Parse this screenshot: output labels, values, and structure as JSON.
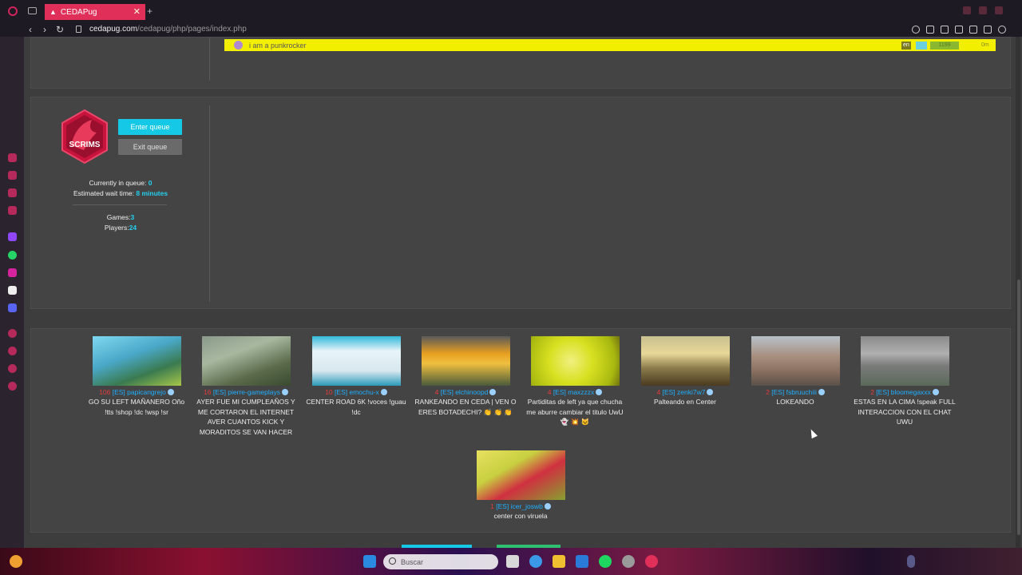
{
  "browser": {
    "tab_title": "CEDAPug",
    "new_tab": "+",
    "url_domain": "cedapug.com",
    "url_path": "/cedapug/php/pages/index.php"
  },
  "top_row": {
    "message": "i am a punkrocker",
    "lang_badge": "en",
    "rating": "1199",
    "time": "0m"
  },
  "queue": {
    "logo_text": "SCRIMS",
    "enter_label": "Enter queue",
    "exit_label": "Exit queue",
    "in_queue_label": "Currently in queue:",
    "in_queue_value": "0",
    "wait_label": "Estimated wait time:",
    "wait_value": "8 minutes",
    "games_label": "Games:",
    "games_value": "3",
    "players_label": "Players:",
    "players_value": "24"
  },
  "streams": [
    {
      "count": "106",
      "name": "[ES] papicangrejo",
      "title": "GO SU LEFT MAÑANERO Oño !tts !shop !dc !wsp !sr"
    },
    {
      "count": "16",
      "name": "[ES] pierre-gameplays",
      "title": "AYER FUE MI CUMPLEAÑOS Y ME CORTARON EL INTERNET AVER CUANTOS KICK Y MORADITOS SE VAN HACER"
    },
    {
      "count": "10",
      "name": "[ES] emochu-x",
      "title": "CENTER ROAD 6K !voces !guau !dc"
    },
    {
      "count": "4",
      "name": "[ES] elchinoopd",
      "title": "RANKEANDO EN CEDA | VEN O ERES BOTADECHI? 👏 👏 👏"
    },
    {
      "count": "4",
      "name": "[ES] maxzzzx",
      "title": "Partiditas de left ya que chucha me aburre cambiar el titulo UwU 👻 💥 🐱"
    },
    {
      "count": "4",
      "name": "[ES] zenki7w7",
      "title": "Palteando en Center"
    },
    {
      "count": "2",
      "name": "[ES] fsbruuchiii",
      "title": "LOKEANDO"
    },
    {
      "count": "2",
      "name": "[ES] bloomegaxxx",
      "title": "ESTAS EN LA CIMA !speak FULL INTERACCION CON EL CHAT UWU"
    },
    {
      "count": "1",
      "name": "[ES] icer_joswb",
      "title": "center con viruela"
    }
  ],
  "taskbar": {
    "search_placeholder": "Buscar"
  },
  "colors": {
    "accent_cyan": "#14c8e6",
    "brand_red": "#e0305a",
    "viewer_count_red": "#e53b3b",
    "stream_name_blue": "#1fb0ff",
    "highlight_yellow": "#f2ef00"
  }
}
